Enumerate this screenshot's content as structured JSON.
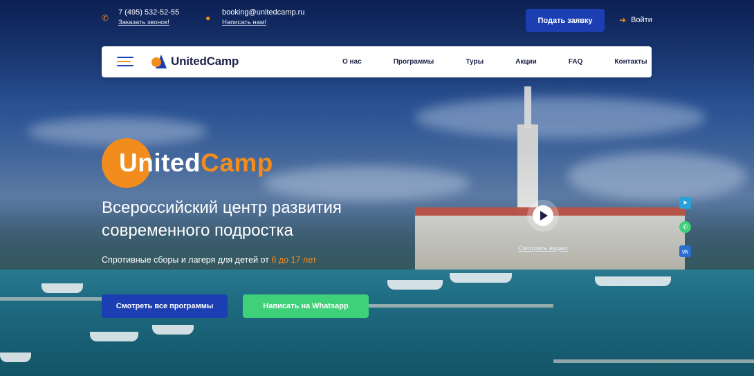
{
  "topbar": {
    "phone": "7 (495) 532-52-55",
    "phone_link": "Заказать звонок!",
    "email": "booking@unitedcamp.ru",
    "email_link": "Написать нам!",
    "apply_button": "Подать заявку",
    "login": "Войти"
  },
  "nav": {
    "logo_text": "UnitedCamp",
    "items": [
      "О нас",
      "Программы",
      "Туры",
      "Акции",
      "FAQ",
      "Контакты"
    ]
  },
  "hero": {
    "logo_part1": "United",
    "logo_part2": "Camp",
    "title": "Всероссийский центр развития современного подростка",
    "subtitle_prefix": "Спротивные сборы и лагеря для детей от ",
    "subtitle_highlight": "6 до 17 лет",
    "btn_programs": "Смотреть все программы",
    "btn_whatsapp": "Написать на Whatsapp",
    "video_label": "Смотреть видео"
  },
  "social": {
    "telegram": "telegram-icon",
    "whatsapp": "whatsapp-icon",
    "vk": "vk-icon"
  },
  "colors": {
    "accent_orange": "#f28c1c",
    "brand_blue": "#1b3fb3",
    "whatsapp_green": "#3fd07a"
  }
}
